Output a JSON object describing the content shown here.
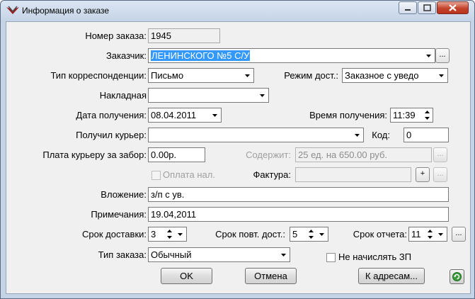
{
  "window": {
    "title": "Информация о заказе"
  },
  "icons": {
    "app": "app-logo-icon",
    "minimize": "minimize-icon",
    "maximize": "maximize-icon",
    "close": "close-icon",
    "dropdown": "chevron-down-icon",
    "spin": "spin-updown-icon",
    "refresh": "refresh-icon"
  },
  "colors": {
    "selection": "#3399ff",
    "close_button": "#c4432b"
  },
  "form": {
    "order_number": {
      "label": "Номер заказа:",
      "value": "1945"
    },
    "customer": {
      "label": "Заказчик:",
      "value": "ЛЕНИНСКОГО №5 С/У",
      "more": "..."
    },
    "correspondence_type": {
      "label": "Тип корреспонденции:",
      "value": "Письмо"
    },
    "delivery_mode": {
      "label": "Режим дост.:",
      "value": "Заказное с уведо"
    },
    "invoice_doc": {
      "label": "Накладная",
      "value": ""
    },
    "receive_date": {
      "label": "Дата получения:",
      "value": "08.04.2011"
    },
    "receive_time": {
      "label": "Время получения:",
      "value": "11:39"
    },
    "courier": {
      "label": "Получил курьер:",
      "value": ""
    },
    "code": {
      "label": "Код:",
      "value": "0"
    },
    "courier_fee": {
      "label": "Плата курьеру за забор:",
      "value": "0.00р."
    },
    "contents": {
      "label": "Содержит:",
      "value": "25 ед. на  650.00 руб.",
      "more": "..."
    },
    "cash_payment": {
      "label": "Оплата нал.",
      "checked": false
    },
    "facture": {
      "label": "Фактура:",
      "value": "",
      "add": "+",
      "more": "..."
    },
    "attachment": {
      "label": "Вложение:",
      "value": "з/п с ув."
    },
    "notes": {
      "label": "Примечания:",
      "value": "19.04,2011"
    },
    "delivery_term": {
      "label": "Срок доставки:",
      "value": "3"
    },
    "repeat_term": {
      "label": "Срок повт. дост.:",
      "value": "5"
    },
    "report_term": {
      "label": "Срок отчета:",
      "value": "11",
      "more": "..."
    },
    "order_type": {
      "label": "Тип заказа:",
      "value": "Обычный"
    },
    "no_salary": {
      "label": "Не начислять ЗП",
      "checked": false
    }
  },
  "buttons": {
    "ok": "OK",
    "cancel": "Отмена",
    "to_addresses": "К адресам..."
  }
}
